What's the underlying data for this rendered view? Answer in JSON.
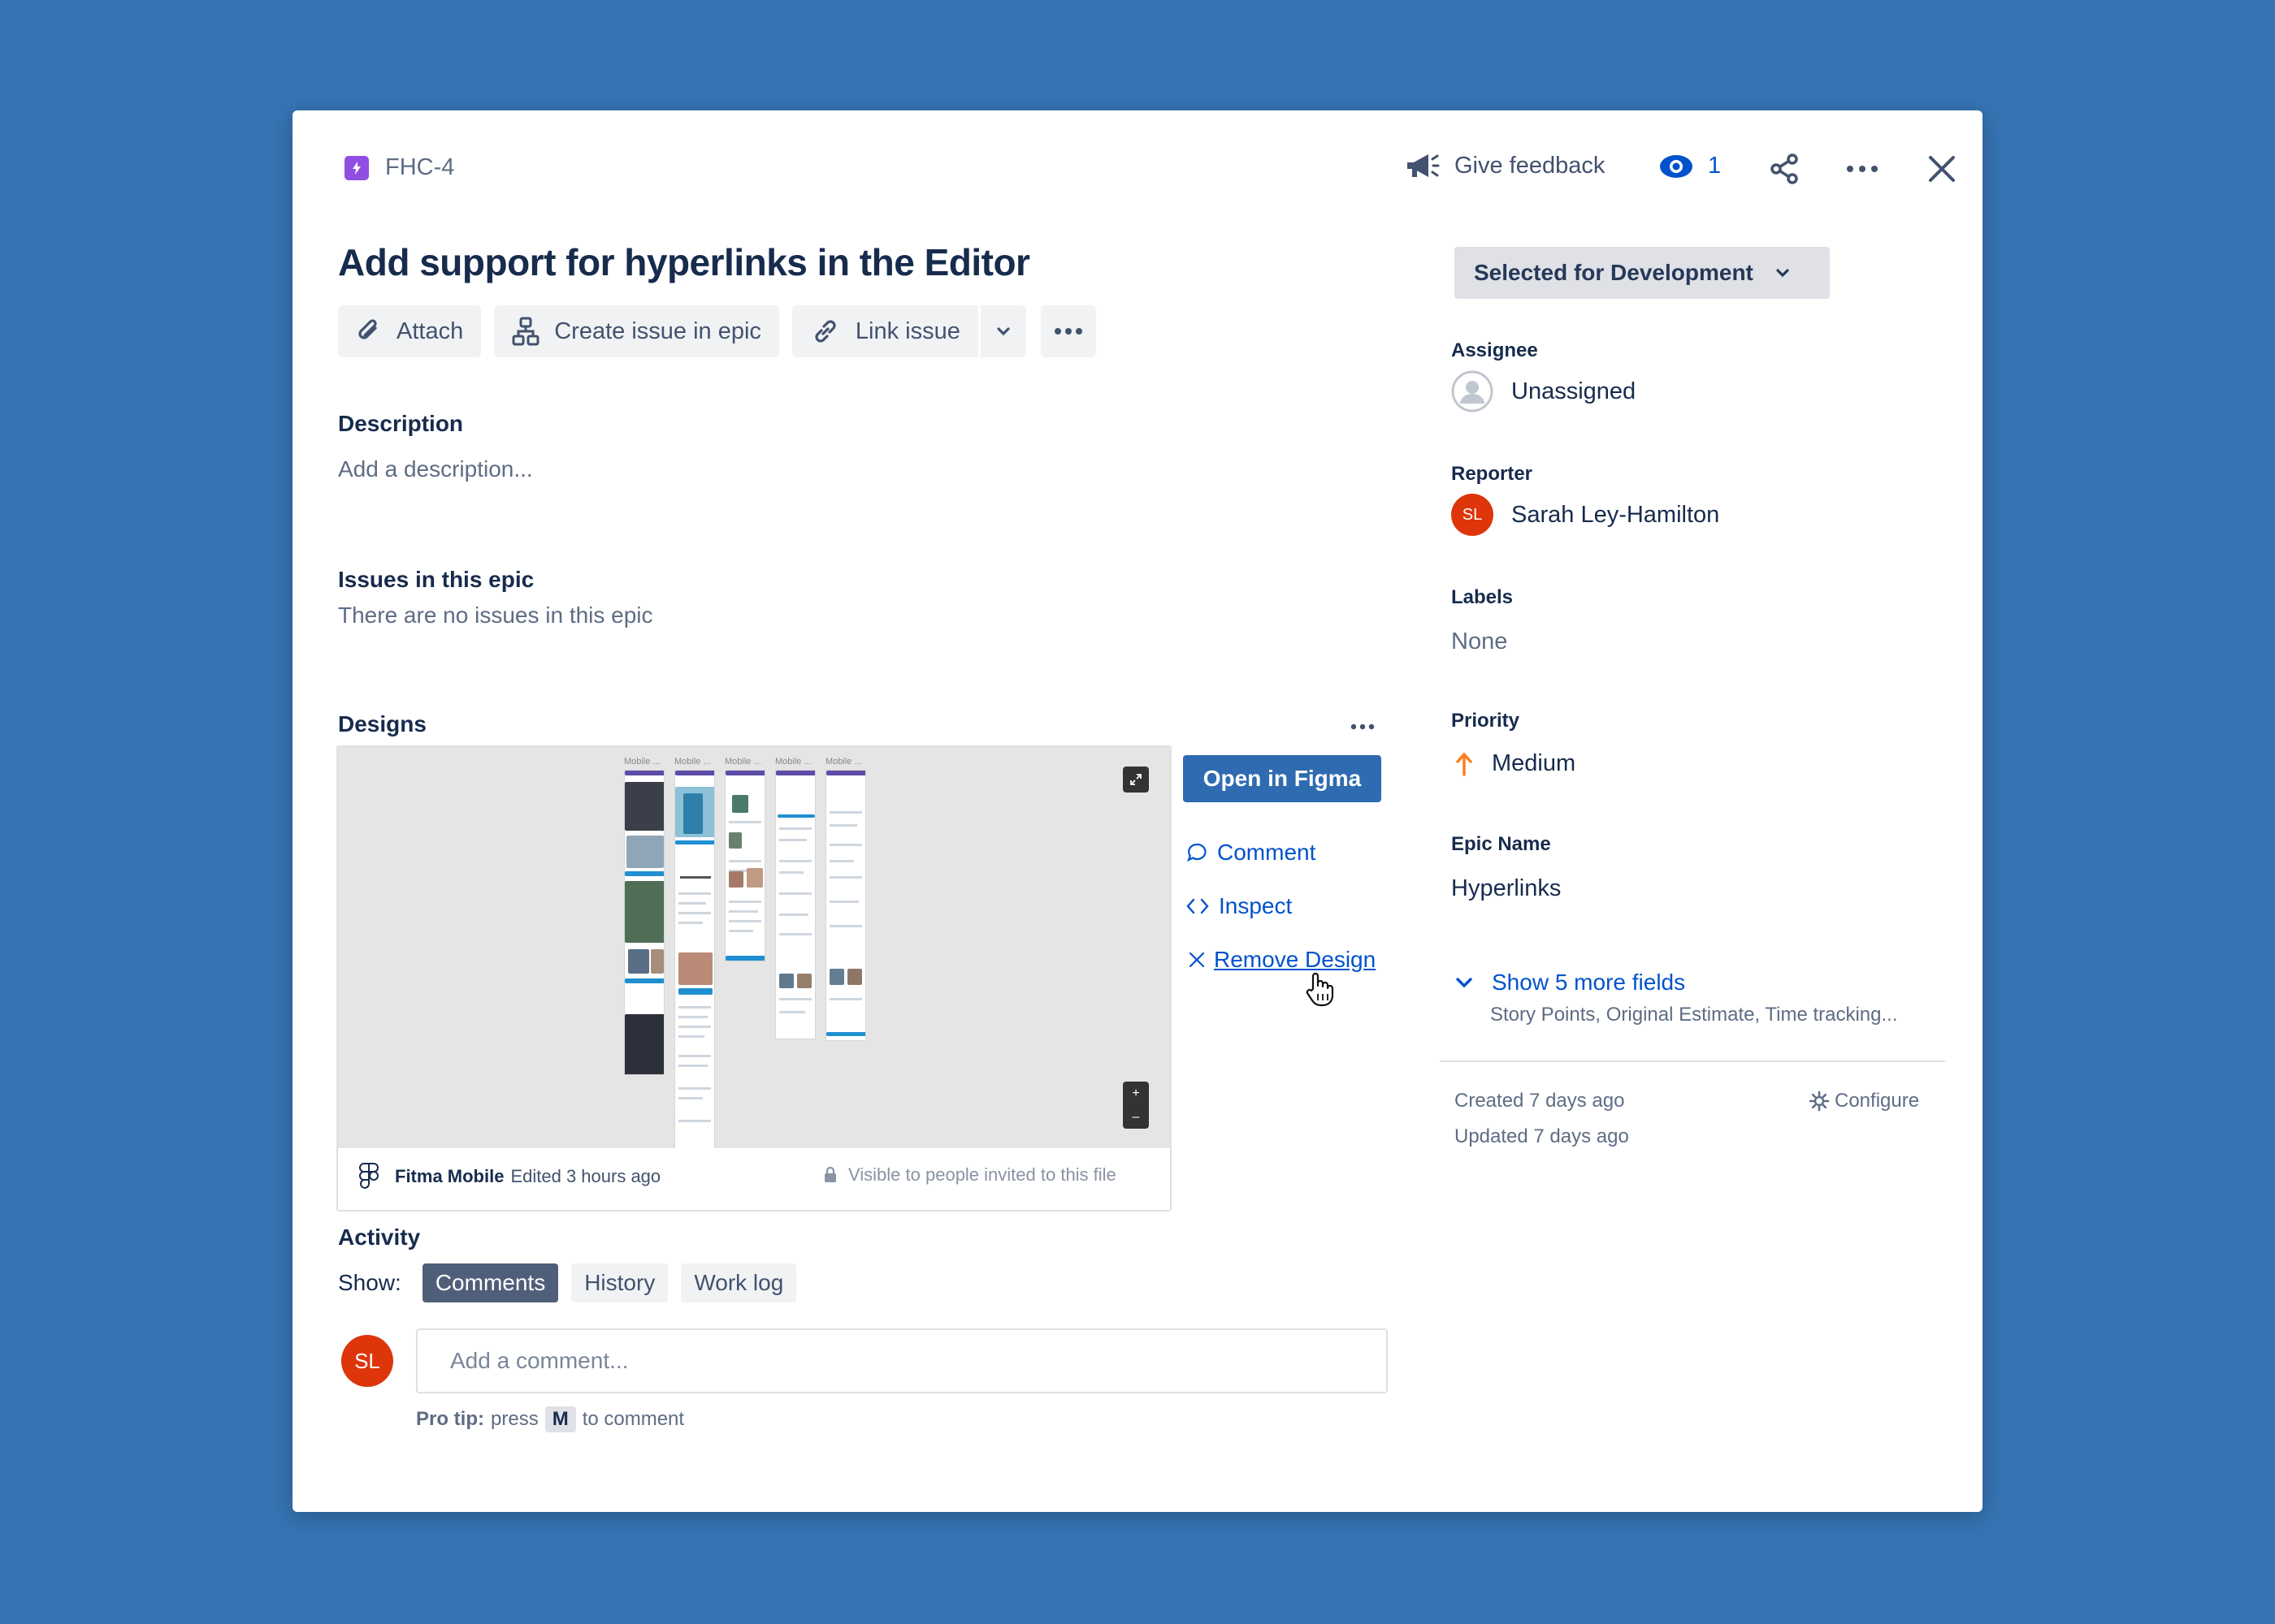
{
  "header": {
    "issue_key": "FHC-4",
    "feedback_label": "Give feedback",
    "watch_count": "1"
  },
  "issue": {
    "title": "Add support for hyperlinks in the Editor"
  },
  "toolbar": {
    "attach": "Attach",
    "create_in_epic": "Create issue in epic",
    "link_issue": "Link issue"
  },
  "description": {
    "label": "Description",
    "placeholder": "Add a description..."
  },
  "epic_issues": {
    "label": "Issues in this epic",
    "empty": "There are no issues in this epic"
  },
  "designs": {
    "label": "Designs",
    "frame_labels": [
      "Mobile ...",
      "Mobile ...",
      "Mobile ...",
      "Mobile ...",
      "Mobile ..."
    ],
    "file_name": "Fitma Mobile",
    "edited": "Edited 3 hours ago",
    "visibility": "Visible to people invited to this file",
    "open_figma": "Open in Figma",
    "comment": "Comment",
    "inspect": "Inspect",
    "remove": "Remove Design"
  },
  "activity": {
    "label": "Activity",
    "show_label": "Show:",
    "tabs": [
      "Comments",
      "History",
      "Work log"
    ],
    "comment_placeholder": "Add a comment...",
    "avatar_initials": "SL",
    "pro_tip_bold": "Pro tip:",
    "pro_tip_press": "press",
    "pro_tip_key": "M",
    "pro_tip_rest": "to comment"
  },
  "sidebar": {
    "status": "Selected for Development",
    "assignee_label": "Assignee",
    "assignee_value": "Unassigned",
    "reporter_label": "Reporter",
    "reporter_initials": "SL",
    "reporter_value": "Sarah Ley-Hamilton",
    "labels_label": "Labels",
    "labels_value": "None",
    "priority_label": "Priority",
    "priority_value": "Medium",
    "epic_name_label": "Epic Name",
    "epic_name_value": "Hyperlinks",
    "more_fields": "Show 5 more fields",
    "more_fields_sub": "Story Points, Original Estimate, Time tracking...",
    "created": "Created 7 days ago",
    "updated": "Updated 7 days ago",
    "configure": "Configure"
  },
  "colors": {
    "background": "#3674B4",
    "primary": "#0052CC",
    "figma_button": "#2F6BB0",
    "avatar_red": "#DE350B",
    "priority_orange": "#FF7B1C",
    "epic_purple": "#904EE2"
  }
}
